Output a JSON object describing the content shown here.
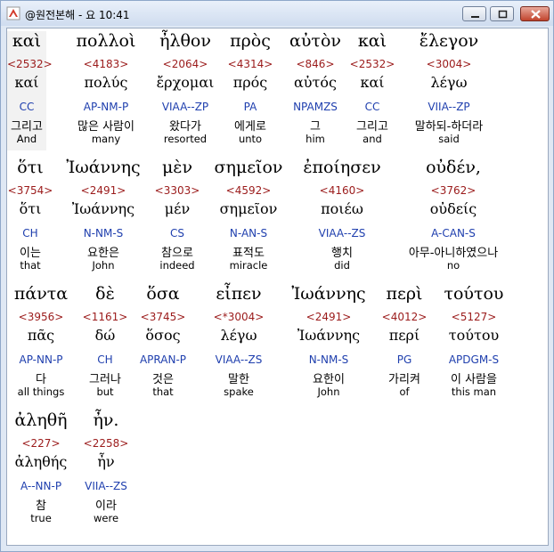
{
  "window": {
    "title": "@원전본해 - 요 10:41"
  },
  "icons": {
    "app": "app-icon",
    "minimize": "minimize-icon",
    "maximize": "maximize-icon",
    "close": "close-icon"
  },
  "rows": [
    {
      "words": [
        {
          "greek": "καὶ",
          "strong": "<2532>",
          "lemma": "καί",
          "morph": "CC",
          "korean": "그리고",
          "english": "And"
        },
        {
          "greek": "πολλοὶ",
          "strong": "<4183>",
          "lemma": "πολύς",
          "morph": "AP-NM-P",
          "korean": "많은 사람이",
          "english": "many"
        },
        {
          "greek": "ἦλθον",
          "strong": "<2064>",
          "lemma": "ἔρχομαι",
          "morph": "VIAA--ZP",
          "korean": "왔다가",
          "english": "resorted"
        },
        {
          "greek": "πρὸς",
          "strong": "<4314>",
          "lemma": "πρός",
          "morph": "PA",
          "korean": "에게로",
          "english": "unto"
        },
        {
          "greek": "αὐτὸν",
          "strong": "<846>",
          "lemma": "αὐτός",
          "morph": "NPAMZS",
          "korean": "그",
          "english": "him"
        },
        {
          "greek": "καὶ",
          "strong": "<2532>",
          "lemma": "καί",
          "morph": "CC",
          "korean": "그리고",
          "english": "and"
        },
        {
          "greek": "ἔλεγον",
          "strong": "<3004>",
          "lemma": "λέγω",
          "morph": "VIIA--ZP",
          "korean": "말하되-하더라",
          "english": "said"
        }
      ]
    },
    {
      "words": [
        {
          "greek": "ὅτι",
          "strong": "<3754>",
          "lemma": "ὅτι",
          "morph": "CH",
          "korean": "이는",
          "english": "that"
        },
        {
          "greek": "Ἰωάννης",
          "strong": "<2491>",
          "lemma": "Ἰωάννης",
          "morph": "N-NM-S",
          "korean": "요한은",
          "english": "John"
        },
        {
          "greek": "μὲν",
          "strong": "<3303>",
          "lemma": "μέν",
          "morph": "CS",
          "korean": "참으로",
          "english": "indeed"
        },
        {
          "greek": "σημεῖον",
          "strong": "<4592>",
          "lemma": "σημεῖον",
          "morph": "N-AN-S",
          "korean": "표적도",
          "english": "miracle"
        },
        {
          "greek": "ἐποίησεν",
          "strong": "<4160>",
          "lemma": "ποιέω",
          "morph": "VIAA--ZS",
          "korean": "행치",
          "english": "did"
        },
        {
          "greek": "οὐδέν,",
          "strong": "<3762>",
          "lemma": "οὐδείς",
          "morph": "A-CAN-S",
          "korean": "아무-아니하였으나",
          "english": "no"
        }
      ]
    },
    {
      "words": [
        {
          "greek": "πάντα",
          "strong": "<3956>",
          "lemma": "πᾶς",
          "morph": "AP-NN-P",
          "korean": "다",
          "english": "all things"
        },
        {
          "greek": "δὲ",
          "strong": "<1161>",
          "lemma": "δώ",
          "morph": "CH",
          "korean": "그러나",
          "english": "but"
        },
        {
          "greek": "ὅσα",
          "strong": "<3745>",
          "lemma": "ὅσος",
          "morph": "APRAN-P",
          "korean": "것은",
          "english": "that"
        },
        {
          "greek": "εἶπεν",
          "strong": "<*3004>",
          "lemma": "λέγω",
          "morph": "VIAA--ZS",
          "korean": "말한",
          "english": "spake"
        },
        {
          "greek": "Ἰωάννης",
          "strong": "<2491>",
          "lemma": "Ἰωάννης",
          "morph": "N-NM-S",
          "korean": "요한이",
          "english": "John"
        },
        {
          "greek": "περὶ",
          "strong": "<4012>",
          "lemma": "περί",
          "morph": "PG",
          "korean": "가리켜",
          "english": "of"
        },
        {
          "greek": "τούτου",
          "strong": "<5127>",
          "lemma": "τούτου",
          "morph": "APDGM-S",
          "korean": "이 사람을",
          "english": "this man"
        }
      ]
    },
    {
      "words": [
        {
          "greek": "ἀληθῆ",
          "strong": "<227>",
          "lemma": "ἀληθής",
          "morph": "A--NN-P",
          "korean": "참",
          "english": "true"
        },
        {
          "greek": "ἦν.",
          "strong": "<2258>",
          "lemma": "ἦν",
          "morph": "VIIA--ZS",
          "korean": "이라",
          "english": "were"
        }
      ]
    }
  ]
}
